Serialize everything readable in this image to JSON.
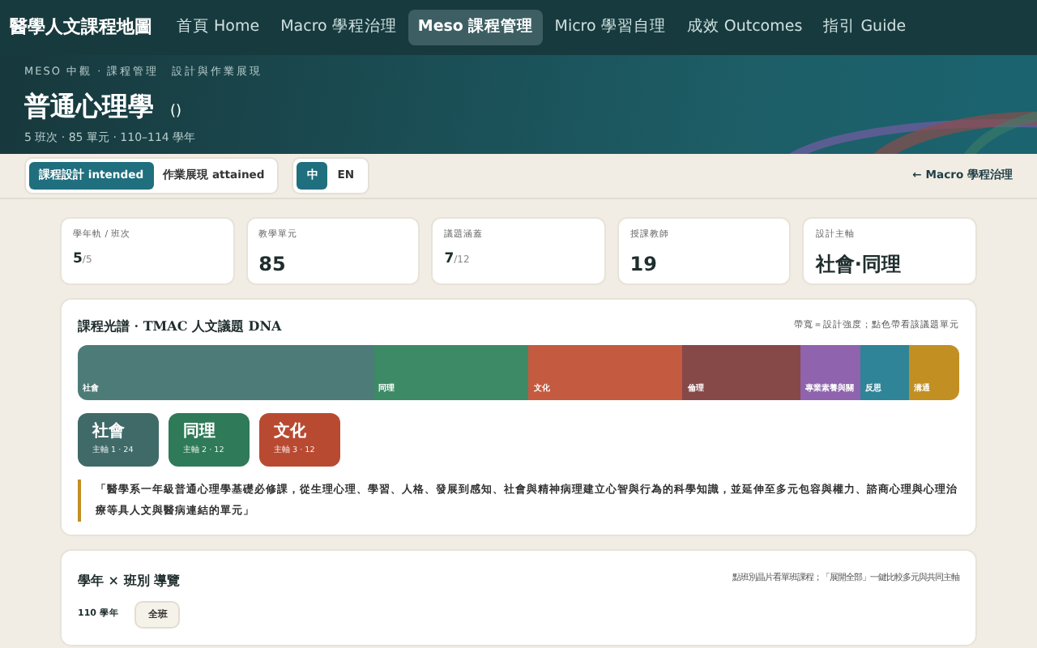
{
  "nav": {
    "brand": "醫學人文課程地圖",
    "items": [
      {
        "label": "首頁 Home",
        "selected": false
      },
      {
        "label": "Macro 學程治理",
        "selected": false
      },
      {
        "label": "Meso 課程管理",
        "selected": true
      },
      {
        "label": "Micro 學習自理",
        "selected": false
      },
      {
        "label": "成效 Outcomes",
        "selected": false
      },
      {
        "label": "指引 Guide",
        "selected": false
      }
    ]
  },
  "hero": {
    "breadcrumb": "MESO 中觀 · 課程管理　設計與作業展現",
    "title": "普通心理學",
    "title_suffix": "()",
    "meta": "5 班次 · 85 單元 · 110–114 學年"
  },
  "toolbar": {
    "modes": [
      {
        "label": "課程設計 intended",
        "selected": true
      },
      {
        "label": "作業展現 attained",
        "selected": false
      }
    ],
    "languages": [
      {
        "label": "中",
        "selected": true
      },
      {
        "label": "EN",
        "selected": false
      }
    ],
    "back_link": "← Macro 學程治理"
  },
  "stats": [
    {
      "label": "學年軌 / 班次",
      "value": "5",
      "total": "/5"
    },
    {
      "label": "教學單元",
      "value": "85"
    },
    {
      "label": "議題涵蓋",
      "value": "7",
      "total": "/12"
    },
    {
      "label": "授課教師",
      "value": "19"
    },
    {
      "label": "設計主軸",
      "value": "社會·同理"
    }
  ],
  "dna": {
    "title": "課程光譜 · TMAC 人文議題 DNA",
    "hint": "帶寬＝設計強度；點色帶看該議題單元",
    "segments": [
      {
        "label": "社會",
        "color": "#4d7b78"
      },
      {
        "label": "同理",
        "color": "#3d8a66"
      },
      {
        "label": "文化",
        "color": "#c45a40"
      },
      {
        "label": "倫理",
        "color": "#874848"
      },
      {
        "label": "專業素養與關",
        "color": "#8f63ad"
      },
      {
        "label": "反思",
        "color": "#2f8497"
      },
      {
        "label": "溝通",
        "color": "#c28f22"
      }
    ],
    "axes": [
      {
        "name": "社會",
        "caption": "主軸 1 · 24",
        "color": "#3f6a67"
      },
      {
        "name": "同理",
        "caption": "主軸 2 · 12",
        "color": "#2f7a58"
      },
      {
        "name": "文化",
        "caption": "主軸 3 · 12",
        "color": "#b94a32"
      }
    ],
    "quote": "「醫學系一年級普通心理學基礎必修課，從生理心理、學習、人格、發展到感知、社會與精神病理建立心智與行為的科學知識，並延伸至多元包容與權力、諮商心理與心理治療等具人文與醫病連結的單元」"
  },
  "overview": {
    "title": "學年 × 班別 導覽",
    "hint": "點班別晶片看單班課程；「展開全部」一鍵比較多元與共同主軸",
    "year": "110 學年",
    "chips": [
      {
        "label": "全班",
        "selected": false
      }
    ]
  }
}
